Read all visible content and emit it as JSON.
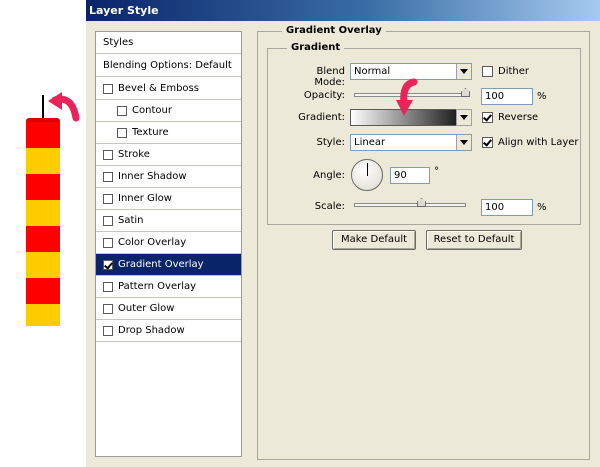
{
  "window": {
    "title": "Layer Style"
  },
  "styles_panel": {
    "header": "Styles",
    "blending": "Blending Options: Default",
    "items": [
      {
        "label": "Bevel & Emboss",
        "checked": false
      },
      {
        "label": "Contour",
        "checked": false
      },
      {
        "label": "Texture",
        "checked": false
      },
      {
        "label": "Stroke",
        "checked": false
      },
      {
        "label": "Inner Shadow",
        "checked": false
      },
      {
        "label": "Inner Glow",
        "checked": false
      },
      {
        "label": "Satin",
        "checked": false
      },
      {
        "label": "Color Overlay",
        "checked": false
      },
      {
        "label": "Gradient Overlay",
        "checked": true
      },
      {
        "label": "Pattern Overlay",
        "checked": false
      },
      {
        "label": "Outer Glow",
        "checked": false
      },
      {
        "label": "Drop Shadow",
        "checked": false
      }
    ]
  },
  "gradient_overlay": {
    "title": "Gradient Overlay",
    "group_title": "Gradient",
    "blend_mode": {
      "label": "Blend Mode:",
      "value": "Normal"
    },
    "dither": {
      "label": "Dither",
      "checked": false
    },
    "opacity": {
      "label": "Opacity:",
      "value": "100",
      "unit": "%",
      "level": 1.0
    },
    "gradient": {
      "label": "Gradient:",
      "colors": [
        "#ffffff",
        "#000000"
      ]
    },
    "reverse": {
      "label": "Reverse",
      "checked": true
    },
    "style": {
      "label": "Style:",
      "value": "Linear"
    },
    "align_with_layer": {
      "label": "Align with Layer",
      "checked": true
    },
    "angle": {
      "label": "Angle:",
      "value": "90",
      "unit": "°"
    },
    "scale": {
      "label": "Scale:",
      "value": "100",
      "unit": "%",
      "level": 0.5
    }
  },
  "buttons": {
    "make_default": "Make Default",
    "reset_to_default": "Reset to Default"
  },
  "colors": {
    "selection": "#0a246a",
    "dialog_bg": "#ece9d8",
    "annotation_arrow": "#e8245a",
    "candle_red": "#ff0000",
    "candle_yellow": "#ffcc00"
  }
}
